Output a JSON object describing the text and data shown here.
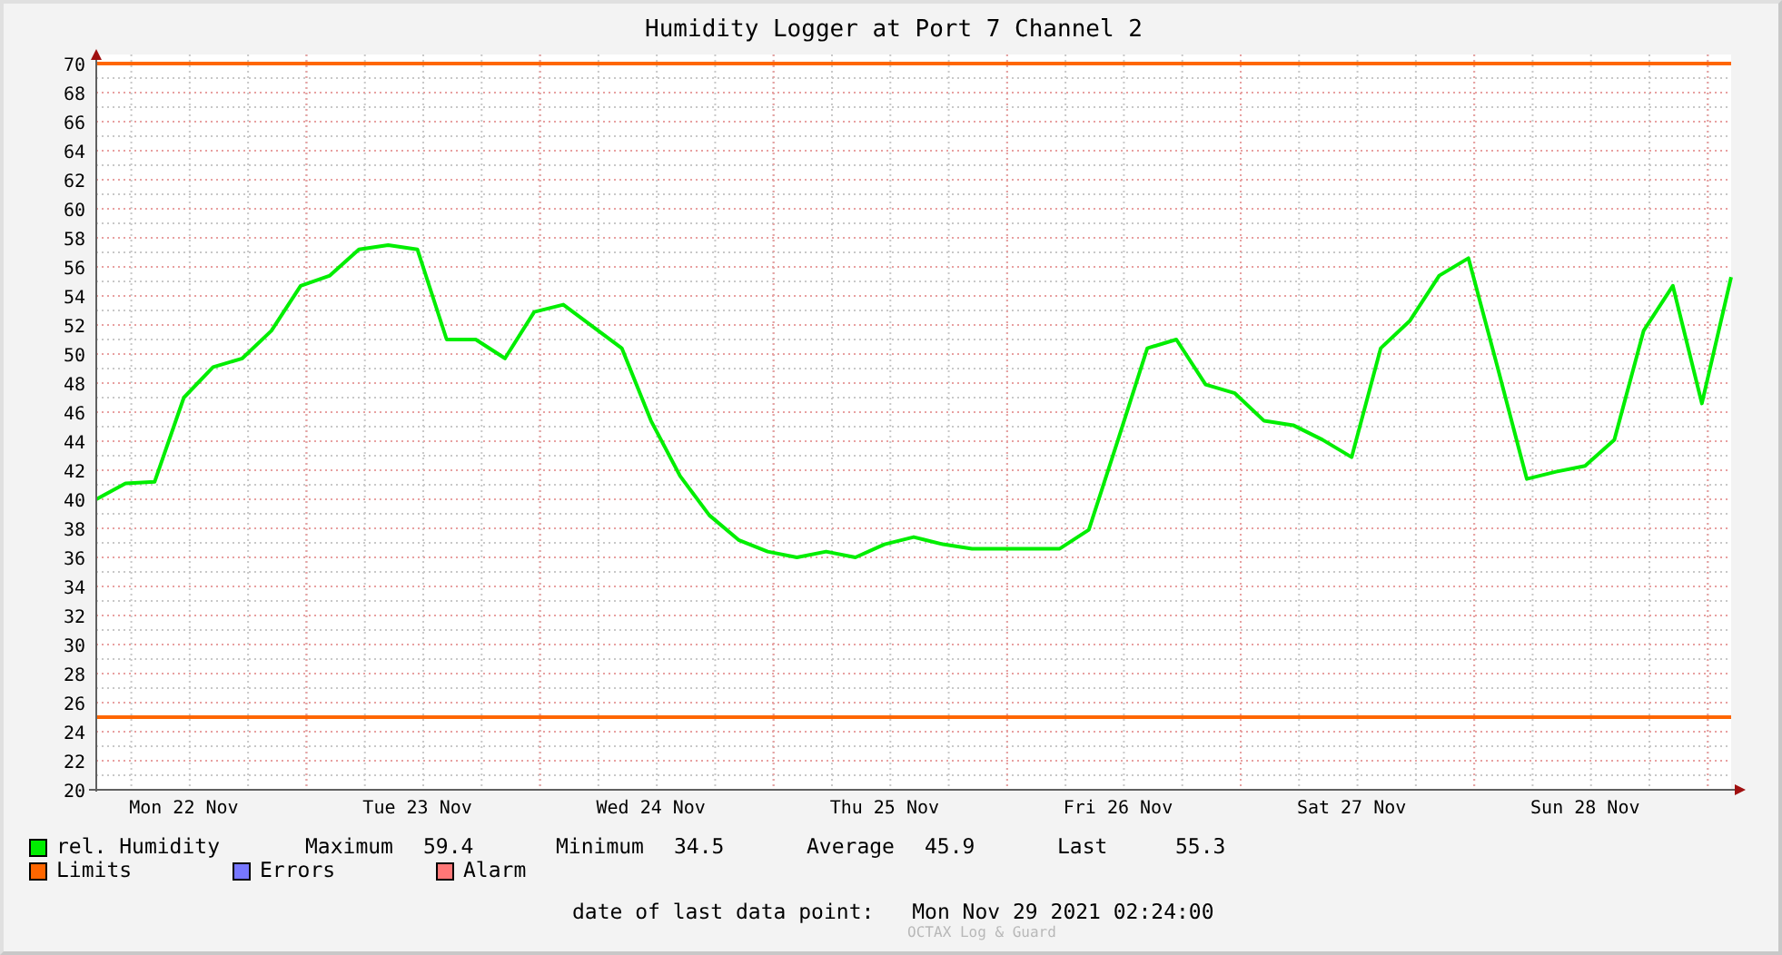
{
  "chart": {
    "chart_data": {
      "type": "line",
      "title": "Humidity Logger at Port 7 Channel 2",
      "categories": [
        null,
        null,
        null,
        "Mon 22 Nov",
        null,
        null,
        null,
        null,
        null,
        null,
        null,
        "Tue 23 Nov",
        null,
        null,
        null,
        null,
        null,
        null,
        null,
        "Wed 24 Nov",
        null,
        null,
        null,
        null,
        null,
        null,
        null,
        "Thu 25 Nov",
        null,
        null,
        null,
        null,
        null,
        null,
        null,
        "Fri 26 Nov",
        null,
        null,
        null,
        null,
        null,
        null,
        null,
        "Sat 27 Nov",
        null,
        null,
        null,
        null,
        null,
        null,
        null,
        "Sun 28 Nov",
        null,
        null,
        null,
        null,
        null
      ],
      "series": [
        {
          "name": "rel. Humidity",
          "color": "#00ee00",
          "values": [
            40,
            41.1,
            41.2,
            47,
            49.1,
            49.7,
            51.6,
            54.7,
            55.4,
            57.2,
            57.5,
            57.2,
            51,
            51,
            49.7,
            52.9,
            53.4,
            51.9,
            50.4,
            45.4,
            41.6,
            38.9,
            37.2,
            36.4,
            36,
            36.4,
            36,
            36.9,
            37.4,
            36.9,
            36.6,
            36.6,
            36.6,
            36.6,
            37.9,
            44.1,
            50.4,
            51,
            47.9,
            47.3,
            45.4,
            45.1,
            44.1,
            42.9,
            50.4,
            52.3,
            55.4,
            56.6,
            49.1,
            41.4,
            41.9,
            42.3,
            44.1,
            51.6,
            54.7,
            46.6,
            55.3
          ]
        }
      ],
      "ylim": [
        20,
        70
      ],
      "yticks": [
        20,
        22,
        24,
        26,
        28,
        30,
        32,
        34,
        36,
        38,
        40,
        42,
        44,
        46,
        48,
        50,
        52,
        54,
        56,
        58,
        60,
        62,
        64,
        66,
        68,
        70
      ],
      "grid": true,
      "ref_lines": [
        {
          "axis": "y",
          "value": 70
        },
        {
          "axis": "y",
          "value": 25
        }
      ]
    }
  },
  "legend": {
    "stats": [
      {
        "label": "Maximum",
        "value": "59.4"
      },
      {
        "label": "Minimum",
        "value": "34.5"
      },
      {
        "label": "Average",
        "value": "45.9"
      },
      {
        "label": "Last",
        "value": "55.3"
      }
    ],
    "items": [
      {
        "label": "Limits",
        "color": "#ff6600"
      },
      {
        "label": "Errors",
        "color": "#7777ff"
      },
      {
        "label": "Alarm",
        "color": "#ff7777"
      }
    ]
  },
  "footer": {
    "label": "date of last data point:",
    "value": "Mon Nov 29 2021 02:24:00",
    "watermark": "OCTAX Log & Guard"
  }
}
